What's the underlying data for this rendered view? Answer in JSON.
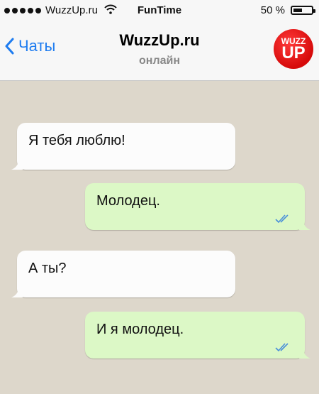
{
  "status_bar": {
    "carrier": "WuzzUp.ru",
    "time": "FunTime",
    "battery_text": "50 %",
    "battery_level": 0.5
  },
  "nav": {
    "back_label": "Чаты",
    "title": "WuzzUp.ru",
    "subtitle": "онлайн",
    "logo_top": "WUZZ",
    "logo_bottom": "UP"
  },
  "messages": [
    {
      "direction": "incoming",
      "text": "Я тебя люблю!"
    },
    {
      "direction": "outgoing",
      "text": "Молодец.",
      "status": "read"
    },
    {
      "direction": "incoming",
      "text": "А ты?"
    },
    {
      "direction": "outgoing",
      "text": "И я молодец.",
      "status": "read"
    }
  ],
  "colors": {
    "accent": "#1e7cf0",
    "incoming_bubble": "#fcfcfc",
    "outgoing_bubble": "#dcf8c6",
    "chat_background": "#ddd7cb",
    "read_ticks": "#4a90d9",
    "logo": "#e0141a"
  },
  "icons": [
    "signal-dots-icon",
    "wifi-icon",
    "battery-icon",
    "chevron-left-icon",
    "double-check-icon"
  ]
}
